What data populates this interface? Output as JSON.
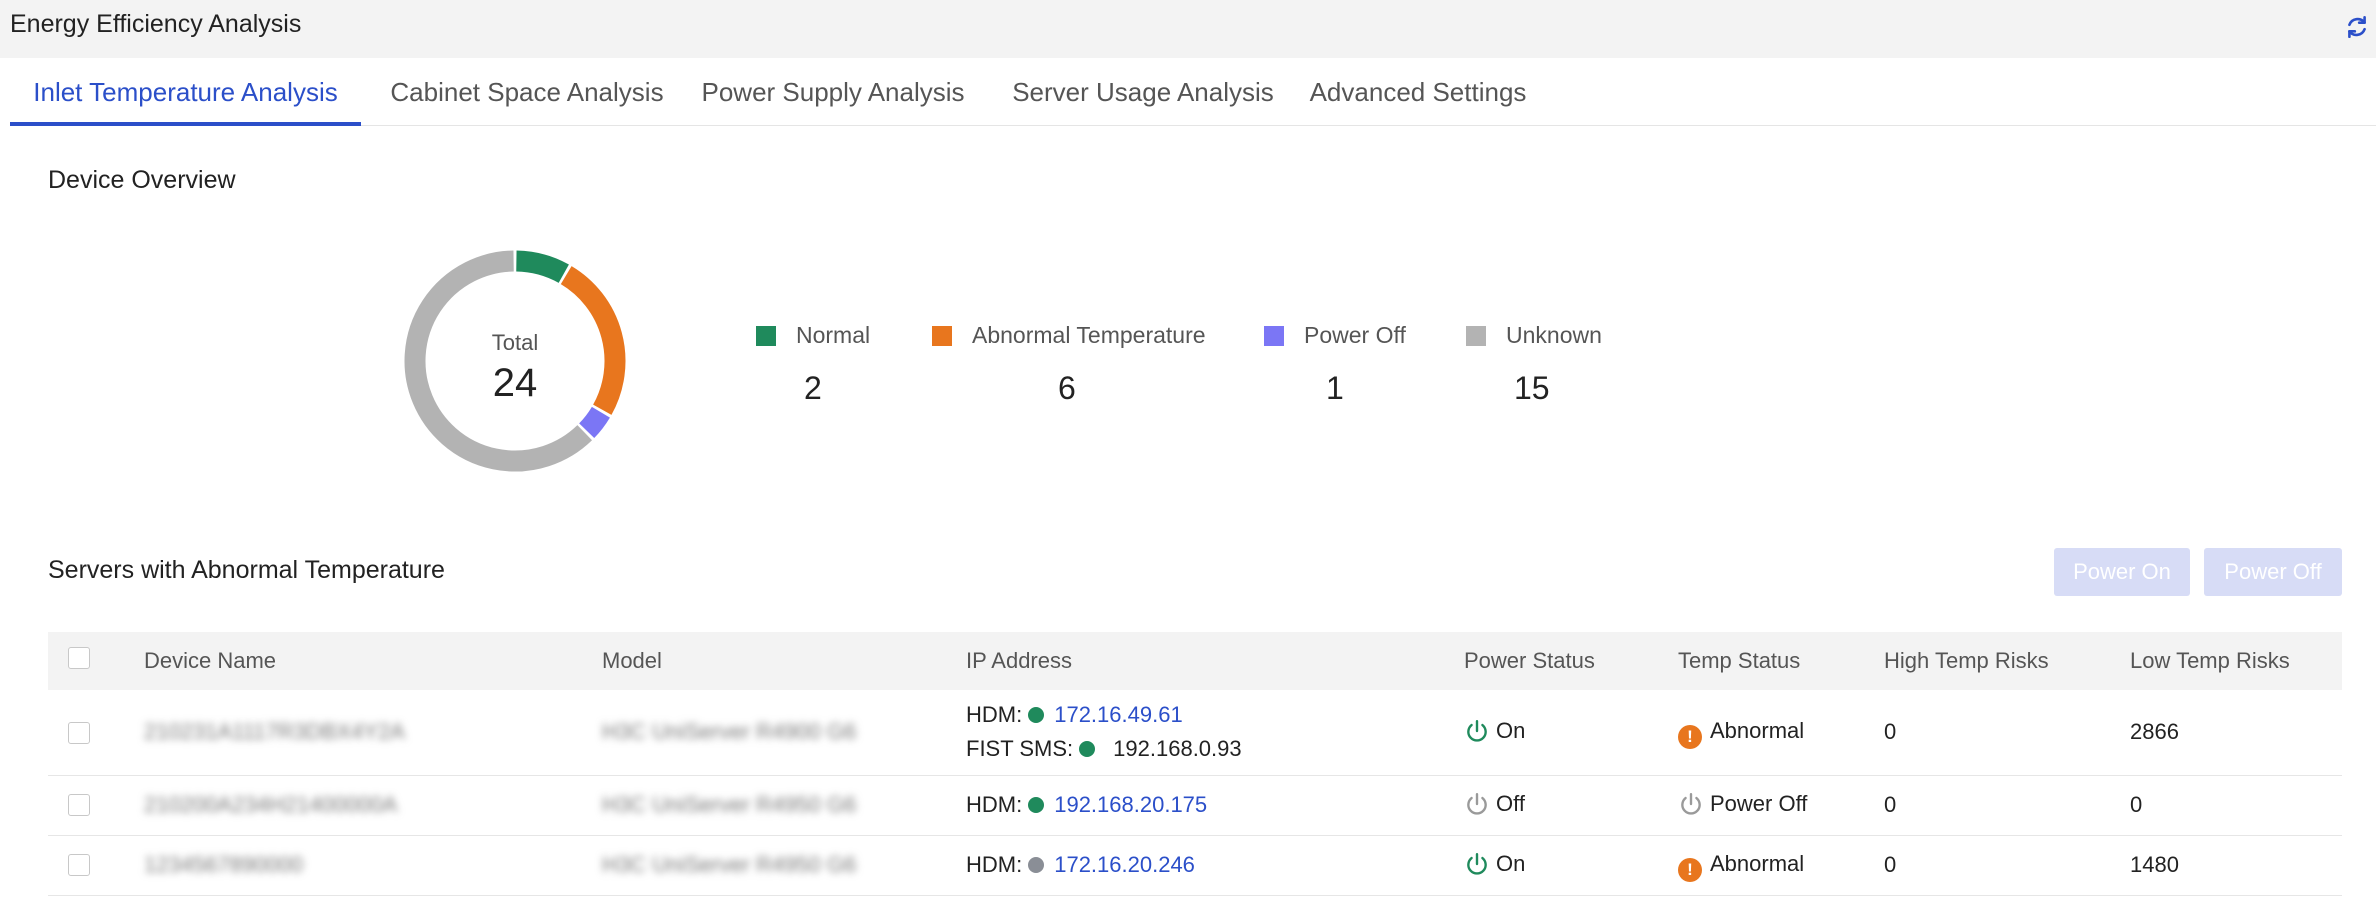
{
  "app": {
    "title": "Energy Efficiency Analysis"
  },
  "tabs": [
    {
      "label": "Inlet Temperature Analysis"
    },
    {
      "label": "Cabinet Space Analysis"
    },
    {
      "label": "Power Supply Analysis"
    },
    {
      "label": "Server Usage Analysis"
    },
    {
      "label": "Advanced Settings"
    }
  ],
  "overview": {
    "title": "Device Overview",
    "total_label": "Total",
    "total_value": "24",
    "segments": [
      {
        "label": "Normal",
        "value": "2",
        "count": 2,
        "color": "#1f8a5c"
      },
      {
        "label": "Abnormal Temperature",
        "value": "6",
        "count": 6,
        "color": "#e8761e"
      },
      {
        "label": "Power Off",
        "value": "1",
        "count": 1,
        "color": "#7b76f5"
      },
      {
        "label": "Unknown",
        "value": "15",
        "count": 15,
        "color": "#b3b3b3"
      }
    ]
  },
  "abnormal": {
    "title": "Servers with Abnormal Temperature",
    "power_on_label": "Power On",
    "power_off_label": "Power Off",
    "columns": [
      "Device Name",
      "Model",
      "IP Address",
      "Power Status",
      "Temp Status",
      "High Temp Risks",
      "Low Temp Risks"
    ],
    "rows": [
      {
        "device_name": "210231A1117R3DBX4Y2A",
        "model": "H3C UniServer R4900 G6",
        "ip_line1_label": "HDM:",
        "ip_line1_value": "172.16.49.61",
        "ip_line2_label": "FIST SMS:",
        "ip_line2_value": "192.168.0.93",
        "power_status": "On",
        "temp_status": "Abnormal",
        "high_temp_risks": "0",
        "low_temp_risks": "2866"
      },
      {
        "device_name": "210200A234H21400000A",
        "model": "H3C UniServer R4950 G6",
        "ip_line1_label": "HDM:",
        "ip_line1_value": "192.168.20.175",
        "power_status": "Off",
        "temp_status": "Power Off",
        "high_temp_risks": "0",
        "low_temp_risks": "0"
      },
      {
        "device_name": "1234567890000",
        "model": "H3C UniServer R4950 G6",
        "ip_line1_label": "HDM:",
        "ip_line1_value": "172.16.20.246",
        "power_status": "On",
        "temp_status": "Abnormal",
        "high_temp_risks": "0",
        "low_temp_risks": "1480"
      }
    ]
  },
  "colors": {
    "accent": "#2b4fc9",
    "status_green": "#1f8a5c",
    "status_grey": "#8a8e96",
    "abnormal_orange": "#e8761e",
    "off_grey": "#9a9a9a"
  },
  "icons": {
    "refresh": "refresh-icon",
    "power_on": "power-on-icon",
    "power_off": "power-off-icon",
    "abnormal": "exclamation-icon"
  }
}
